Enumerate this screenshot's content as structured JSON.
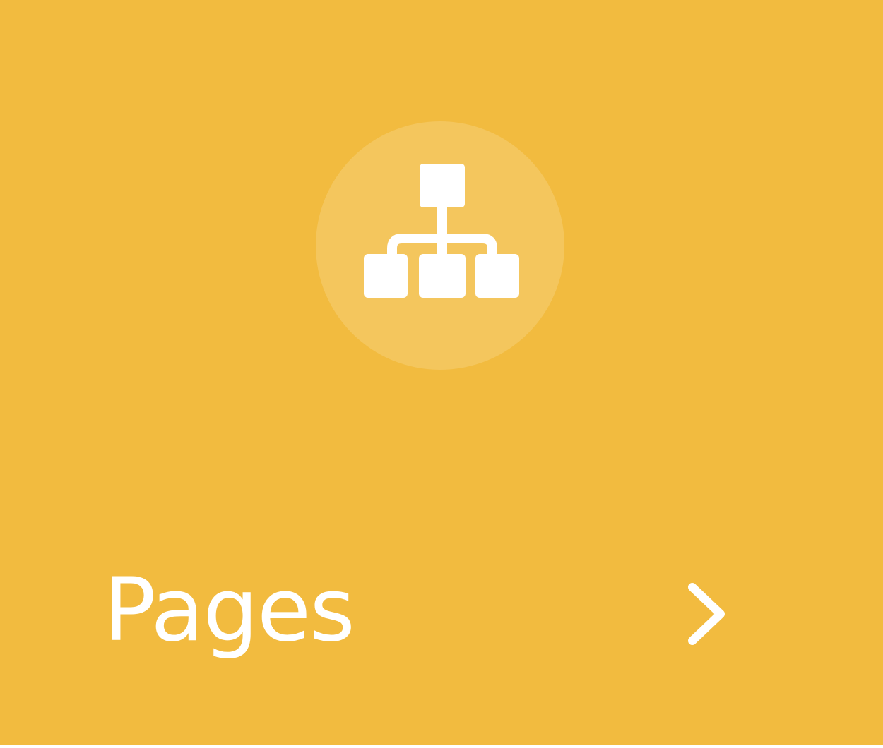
{
  "tile": {
    "label": "Pages",
    "icon": "sitemap-icon",
    "trailing_icon": "chevron-right-icon",
    "background_color": "#F2BB3F",
    "foreground_color": "#FFFFFF"
  }
}
